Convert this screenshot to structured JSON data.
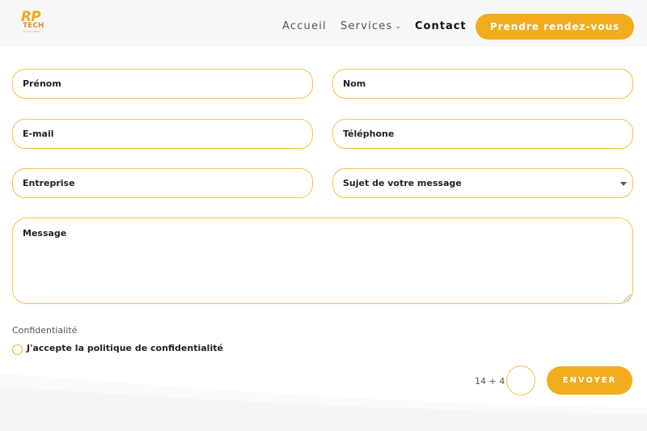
{
  "header": {
    "logo": {
      "mark": "RP",
      "word": "TECH",
      "tagline": "SOLUTIONS"
    },
    "nav": [
      {
        "label": "Accueil"
      },
      {
        "label": "Services",
        "has_dropdown": true
      },
      {
        "label": "Contact",
        "active": true
      }
    ],
    "cta_label": "Prendre rendez-vous"
  },
  "form": {
    "first_name_placeholder": "Prénom",
    "last_name_placeholder": "Nom",
    "email_placeholder": "E-mail",
    "phone_placeholder": "Téléphone",
    "company_placeholder": "Entreprise",
    "subject_selected": "Sujet de votre message",
    "message_placeholder": "Message",
    "privacy_section_label": "Confidentialité",
    "privacy_checkbox_label": "J'accepte la politique de confidentialité",
    "privacy_checked": false,
    "captcha_question": "14 + 4 =",
    "captcha_value": "",
    "submit_label": "ENVOYER"
  },
  "colors": {
    "accent": "#f2ad1e",
    "field_border": "#f2c14a",
    "header_bg": "#f7f7f7",
    "footer_bg": "#f5f5f5"
  }
}
